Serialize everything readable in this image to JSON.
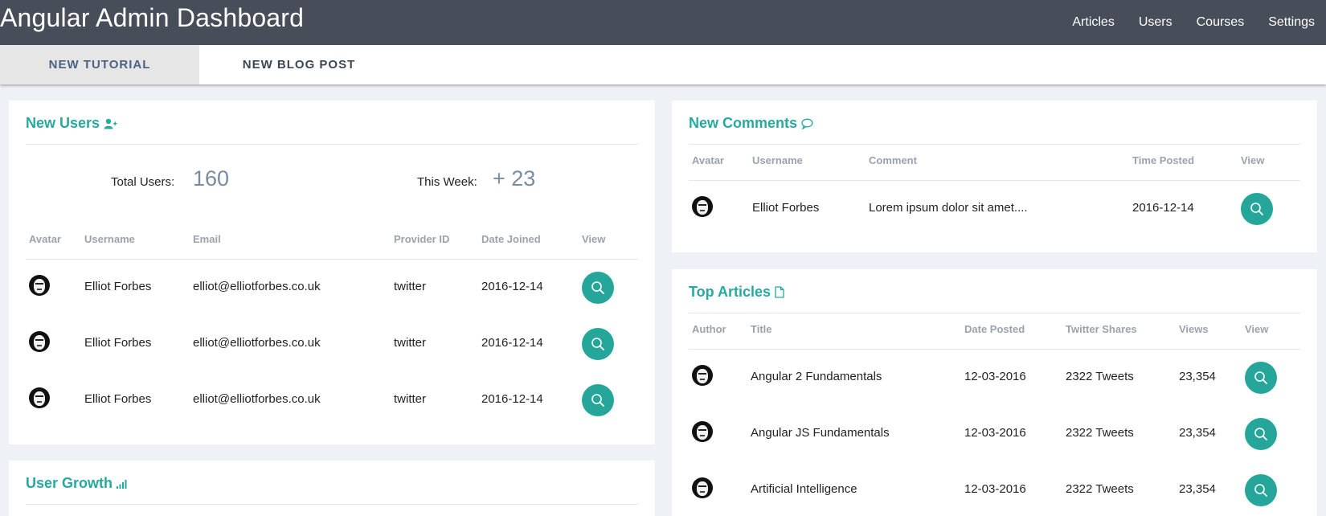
{
  "header": {
    "title": "Angular Admin Dashboard",
    "nav": [
      "Articles",
      "Users",
      "Courses",
      "Settings"
    ]
  },
  "tabs": [
    {
      "label": "NEW TUTORIAL",
      "active": true
    },
    {
      "label": "NEW BLOG POST",
      "active": false
    }
  ],
  "colors": {
    "accent": "#26a69a",
    "header_bg": "#474e5a",
    "page_bg": "#eef1f5"
  },
  "new_users": {
    "title": "New Users",
    "title_icon": "add-user-icon",
    "total_label": "Total Users:",
    "total_value": "160",
    "week_label": "This Week:",
    "week_value": "+ 23",
    "columns": [
      "Avatar",
      "Username",
      "Email",
      "Provider ID",
      "Date Joined",
      "View"
    ],
    "rows": [
      {
        "username": "Elliot Forbes",
        "email": "elliot@elliotforbes.co.uk",
        "provider": "twitter",
        "date": "2016-12-14"
      },
      {
        "username": "Elliot Forbes",
        "email": "elliot@elliotforbes.co.uk",
        "provider": "twitter",
        "date": "2016-12-14"
      },
      {
        "username": "Elliot Forbes",
        "email": "elliot@elliotforbes.co.uk",
        "provider": "twitter",
        "date": "2016-12-14"
      }
    ]
  },
  "user_growth": {
    "title": "User Growth",
    "title_icon": "signal-bars-icon"
  },
  "new_comments": {
    "title": "New Comments",
    "title_icon": "comment-icon",
    "columns": [
      "Avatar",
      "Username",
      "Comment",
      "Time Posted",
      "View"
    ],
    "rows": [
      {
        "username": "Elliot Forbes",
        "comment": "Lorem ipsum dolor sit amet....",
        "time": "2016-12-14"
      }
    ]
  },
  "top_articles": {
    "title": "Top Articles",
    "title_icon": "document-icon",
    "columns": [
      "Author",
      "Title",
      "Date Posted",
      "Twitter Shares",
      "Views",
      "View"
    ],
    "rows": [
      {
        "title": "Angular 2 Fundamentals",
        "date": "12-03-2016",
        "shares": "2322 Tweets",
        "views": "23,354"
      },
      {
        "title": "Angular JS Fundamentals",
        "date": "12-03-2016",
        "shares": "2322 Tweets",
        "views": "23,354"
      },
      {
        "title": "Artificial Intelligence",
        "date": "12-03-2016",
        "shares": "2322 Tweets",
        "views": "23,354"
      }
    ]
  }
}
